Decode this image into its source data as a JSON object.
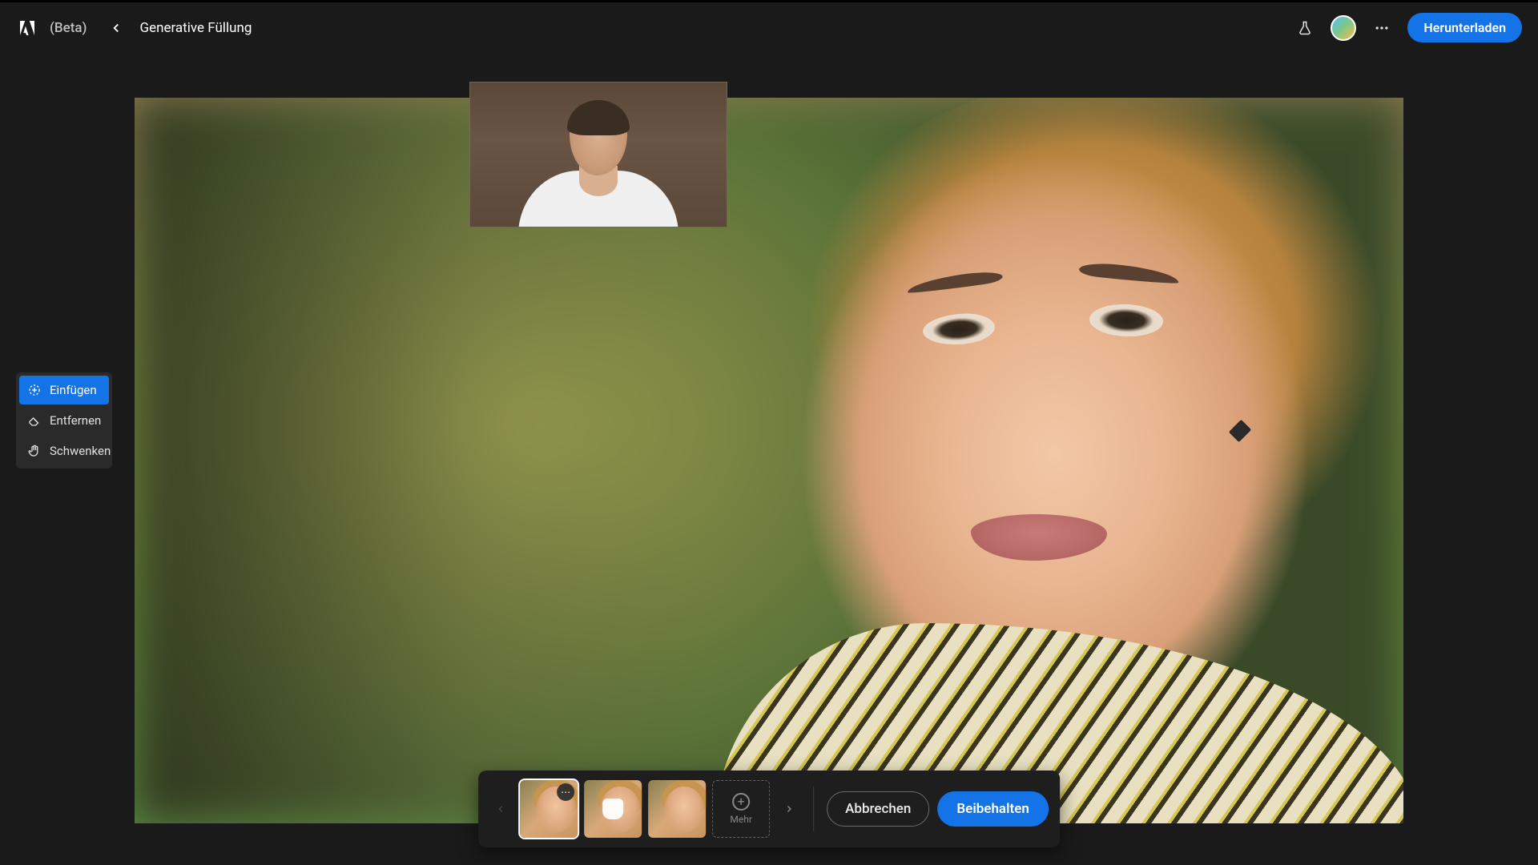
{
  "header": {
    "beta_label": "(Beta)",
    "title": "Generative Füllung",
    "download_label": "Herunterladen"
  },
  "toolbar": {
    "items": [
      {
        "label": "Einfügen",
        "icon": "sparkle-select",
        "active": true
      },
      {
        "label": "Entfernen",
        "icon": "eraser",
        "active": false
      },
      {
        "label": "Schwenken",
        "icon": "hand",
        "active": false
      }
    ]
  },
  "bottom_bar": {
    "more_label": "Mehr",
    "cancel_label": "Abbrechen",
    "keep_label": "Beibehalten",
    "variations_count": 3,
    "selected_index": 0
  }
}
